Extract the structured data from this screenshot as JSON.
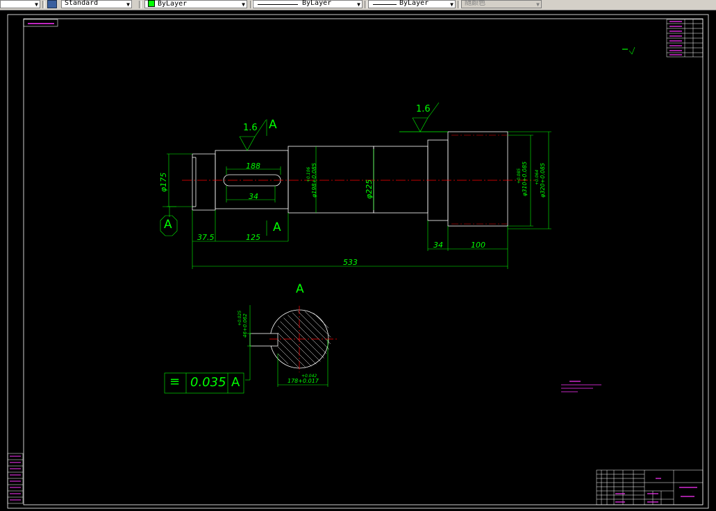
{
  "toolbar": {
    "text_style": "Standard",
    "layer": "ByLayer",
    "linetype": "ByLayer",
    "lineweight": "ByLayer",
    "plot_color": "随颜色"
  },
  "dimensions": {
    "d_175": "φ175",
    "d_188": "188",
    "d_34_key": "34",
    "d_37_5": "37.5",
    "d_125": "125",
    "d_34_step": "34",
    "d_100": "100",
    "d_533": "533",
    "d_198": "φ198+0.085",
    "d_198_tol": "+0.106",
    "d_225": "φ225",
    "d_310": "φ310+0.085",
    "d_310_tol": "+0.085",
    "d_320": "φ320+0.085",
    "d_320_tol": "+0.064",
    "d_178": "178+0.017",
    "d_178_tol": "+0.042",
    "d_keyw": "46+0.062",
    "d_keyw_tol": "+0.025"
  },
  "annotations": {
    "rough_1": "1.6",
    "rough_2": "1.6",
    "section_a1": "A",
    "section_a2": "A",
    "datum_a": "A",
    "section_view": "A",
    "tol_value": "0.035",
    "tol_symbol": "≡",
    "tol_datum": "A"
  },
  "colors": {
    "background": "#000000",
    "outline": "#ffffff",
    "dimension": "#00ff00",
    "centerline": "#ff0000",
    "title_text": "#ff33ff"
  }
}
